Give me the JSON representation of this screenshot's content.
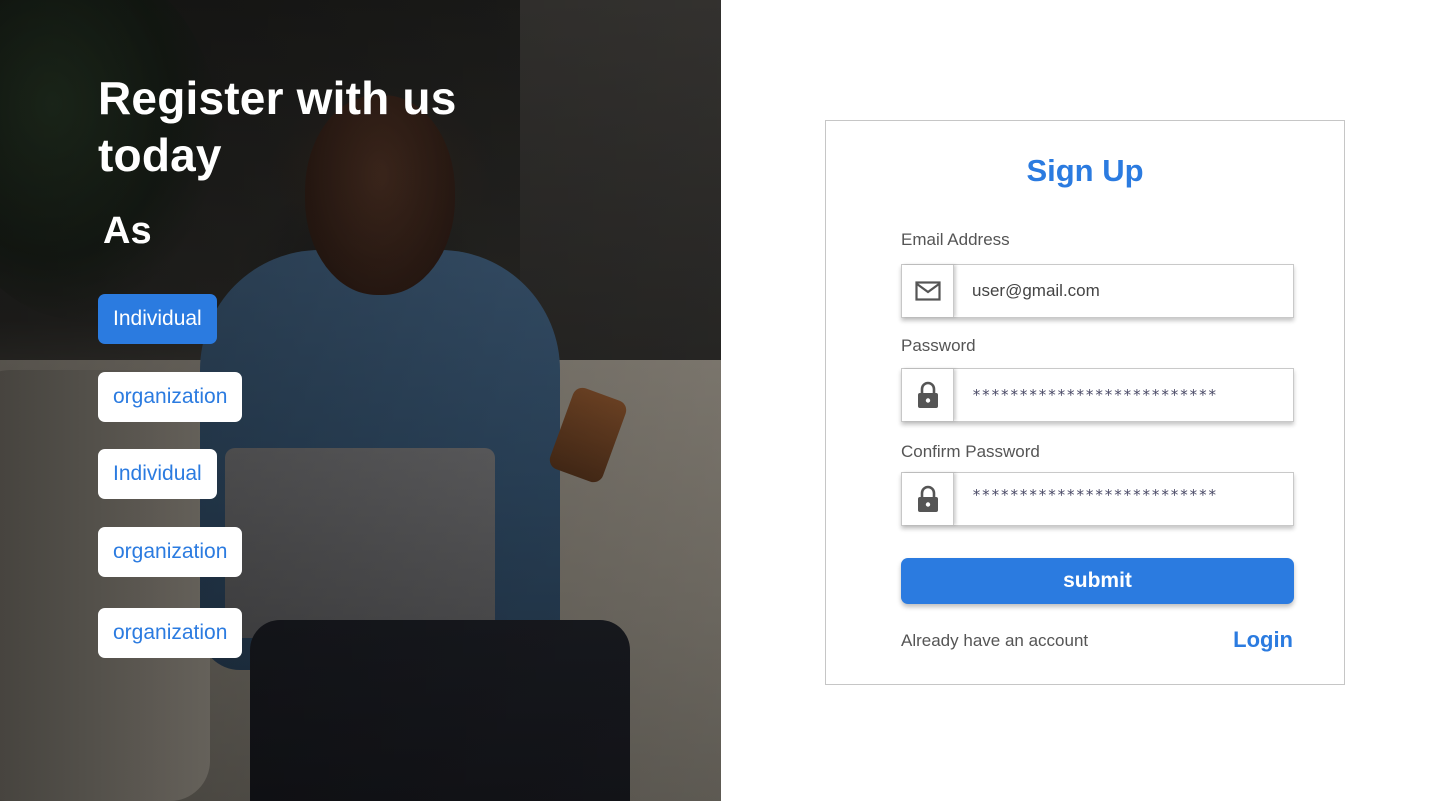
{
  "hero": {
    "title": "Register with us today",
    "subtitle": "As",
    "roles": [
      {
        "label": "Individual",
        "active": true
      },
      {
        "label": "organization",
        "active": false
      },
      {
        "label": "Individual",
        "active": false
      },
      {
        "label": "organization",
        "active": false
      },
      {
        "label": "organization",
        "active": false
      }
    ]
  },
  "signup": {
    "title": "Sign Up",
    "email": {
      "label": "Email Address",
      "value": "user@gmail.com",
      "icon": "mail-icon"
    },
    "password": {
      "label": "Password",
      "value": "**************************",
      "icon": "lock-icon"
    },
    "confirm_password": {
      "label": "Confirm Password",
      "value": "**************************",
      "icon": "lock-icon"
    },
    "submit_label": "submit",
    "already_text": "Already have an account",
    "login_label": "Login"
  },
  "colors": {
    "accent": "#2b7be0",
    "label": "#555555",
    "border": "#c9c9c9"
  }
}
